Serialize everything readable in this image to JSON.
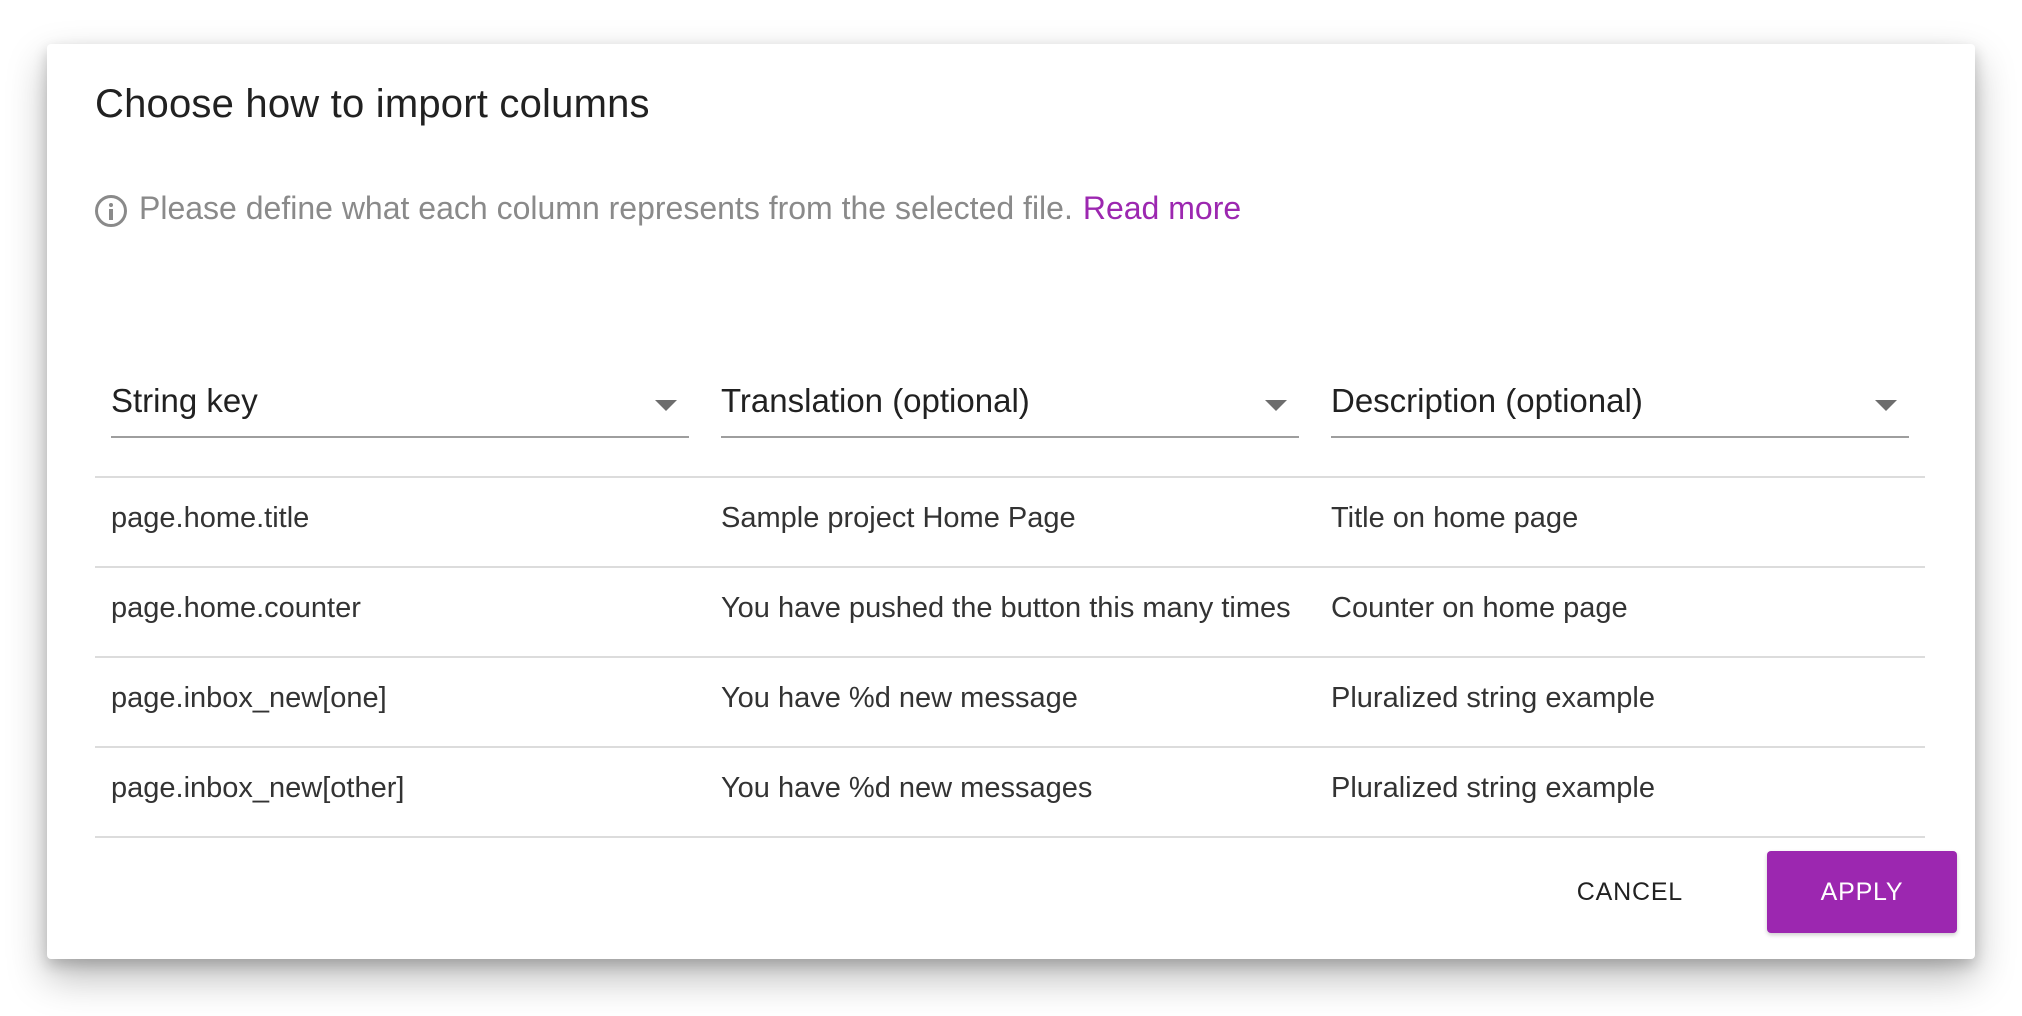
{
  "dialog": {
    "title": "Choose how to import columns",
    "info_text": "Please define what each column represents from the selected file.",
    "read_more_label": "Read more"
  },
  "columns": [
    {
      "selected": "String key"
    },
    {
      "selected": "Translation (optional)"
    },
    {
      "selected": "Description (optional)"
    }
  ],
  "rows": [
    [
      "page.home.title",
      "Sample project Home Page",
      "Title on home page"
    ],
    [
      "page.home.counter",
      "You have pushed the button this many times",
      "Counter on home page"
    ],
    [
      "page.inbox_new[one]",
      "You have %d new message",
      "Pluralized string example"
    ],
    [
      "page.inbox_new[other]",
      "You have %d new messages",
      "Pluralized string example"
    ]
  ],
  "actions": {
    "cancel_label": "CANCEL",
    "apply_label": "APPLY"
  },
  "colors": {
    "accent": "#9c27b0",
    "info_text": "#8a8a8a"
  },
  "icons": [
    "info-icon",
    "dropdown-caret-icon"
  ]
}
